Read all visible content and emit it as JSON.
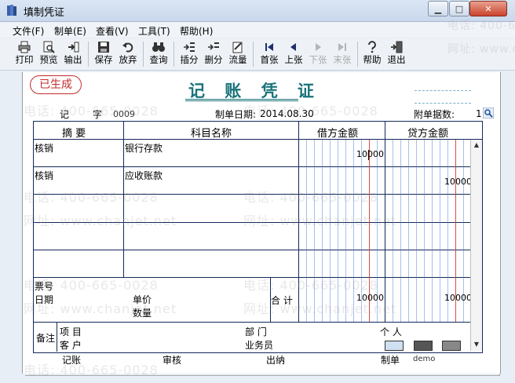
{
  "window": {
    "title": "填制凭证",
    "app_icon": "voucher-book-icon",
    "controls": [
      "minimize-icon",
      "maximize-icon",
      "close-icon"
    ]
  },
  "menu": [
    "文件(F)",
    "制单(E)",
    "查看(V)",
    "工具(T)",
    "帮助(H)"
  ],
  "toolbar": [
    {
      "label": "打印",
      "icon": "printer-icon",
      "enabled": true
    },
    {
      "label": "预览",
      "icon": "preview-icon",
      "enabled": true
    },
    {
      "label": "输出",
      "icon": "export-icon",
      "enabled": true
    },
    {
      "label": "保存",
      "icon": "save-icon",
      "enabled": true
    },
    {
      "label": "放弃",
      "icon": "undo-icon",
      "enabled": true
    },
    {
      "label": "查询",
      "icon": "binoculars-icon",
      "enabled": true
    },
    {
      "label": "插分",
      "icon": "insert-row-icon",
      "enabled": true
    },
    {
      "label": "删分",
      "icon": "delete-row-icon",
      "enabled": true
    },
    {
      "label": "流量",
      "icon": "cashflow-icon",
      "enabled": true
    },
    {
      "label": "首张",
      "icon": "first-icon",
      "enabled": true
    },
    {
      "label": "上张",
      "icon": "prev-icon",
      "enabled": true
    },
    {
      "label": "下张",
      "icon": "next-icon",
      "enabled": false
    },
    {
      "label": "末张",
      "icon": "last-icon",
      "enabled": false
    },
    {
      "label": "帮助",
      "icon": "help-icon",
      "enabled": true
    },
    {
      "label": "退出",
      "icon": "exit-icon",
      "enabled": true
    }
  ],
  "voucher": {
    "status_stamp": "已生成",
    "title": "记 账 凭 证",
    "type_label": "记",
    "number_label": "字",
    "number": "0009",
    "date_label": "制单日期:",
    "date": "2014.08.30",
    "attachments_label": "附单据数:",
    "attachments": "1",
    "headers": {
      "summary": "摘 要",
      "account": "科目名称",
      "debit": "借方金额",
      "credit": "贷方金额"
    },
    "entries": [
      {
        "summary": "核销",
        "account": "银行存款",
        "debit": "10000",
        "credit": ""
      },
      {
        "summary": "核销",
        "account": "应收账款",
        "debit": "",
        "credit": "10000"
      },
      {
        "summary": "",
        "account": "",
        "debit": "",
        "credit": ""
      },
      {
        "summary": "",
        "account": "",
        "debit": "",
        "credit": ""
      }
    ],
    "ticket_label": "票号",
    "date_row_label": "日期",
    "unit_price_label": "单价",
    "quantity_label": "数量",
    "total_label": "合 计",
    "total_debit": "10000",
    "total_credit": "10000",
    "remarks_label": "备注",
    "project_label": "项 目",
    "department_label": "部 门",
    "person_label": "个 人",
    "customer_label": "客 户",
    "salesperson_label": "业务员",
    "footer": {
      "bookkeeping_label": "记账",
      "review_label": "审核",
      "cashier_label": "出纳",
      "preparer_label": "制单",
      "preparer": "demo"
    }
  },
  "watermark": {
    "phone": "电话: 400-665-0028",
    "site": "网址: www.chanjet.net"
  },
  "colors": {
    "title_teal": "#19737a",
    "stamp_red": "#c42b2b",
    "grid_navy": "#14285a",
    "debit_red_line": "#d23b3b",
    "digit_line_blue": "#3f6fd8"
  }
}
